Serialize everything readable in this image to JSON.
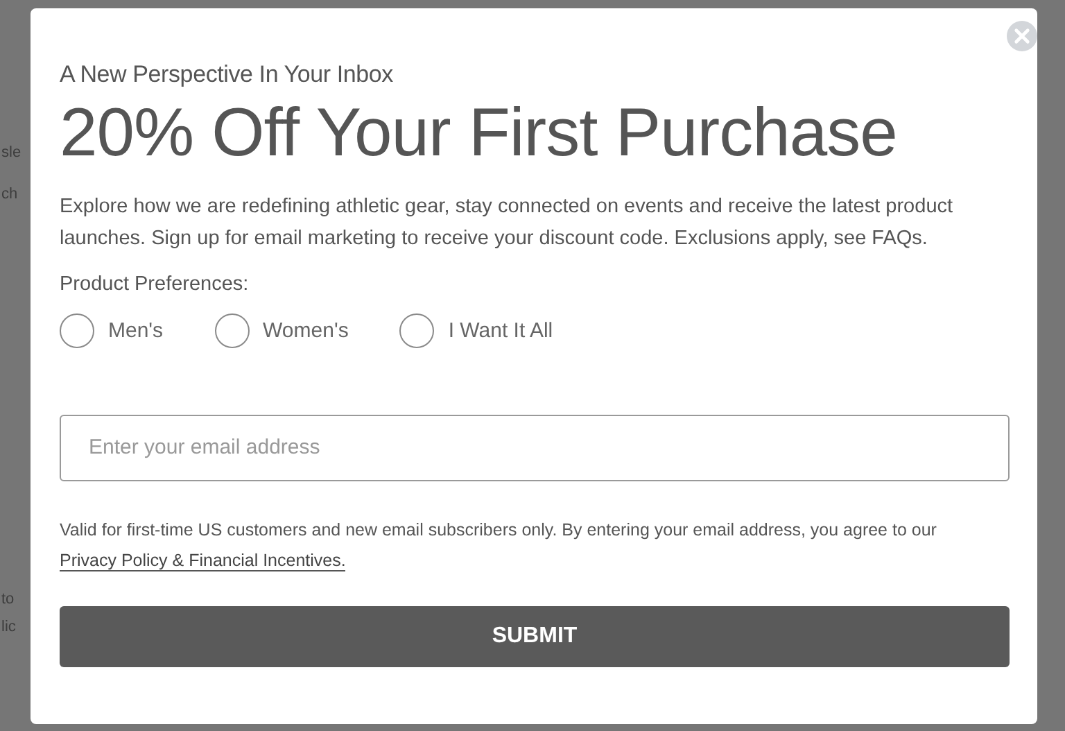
{
  "background_fragments": [
    {
      "text": "sle"
    },
    {
      "text": "ch"
    },
    {
      "text": "to"
    },
    {
      "text": "lic"
    }
  ],
  "modal": {
    "eyebrow": "A New Perspective In Your Inbox",
    "title": "20% Off Your First Purchase",
    "description": "Explore how we are redefining athletic gear, stay connected on events and receive the latest product launches. Sign up for email marketing to receive your discount code. Exclusions apply, see FAQs.",
    "preferences_label": "Product Preferences:",
    "preferences": [
      {
        "label": "Men's",
        "selected": false
      },
      {
        "label": "Women's",
        "selected": false
      },
      {
        "label": "I Want It All",
        "selected": false
      }
    ],
    "email": {
      "placeholder": "Enter your email address"
    },
    "disclaimer": "Valid for first-time US customers and new email subscribers only. By entering your email address, you agree to our",
    "policy_link": "Privacy Policy &  Financial Incentives.",
    "submit": "SUBMIT"
  }
}
